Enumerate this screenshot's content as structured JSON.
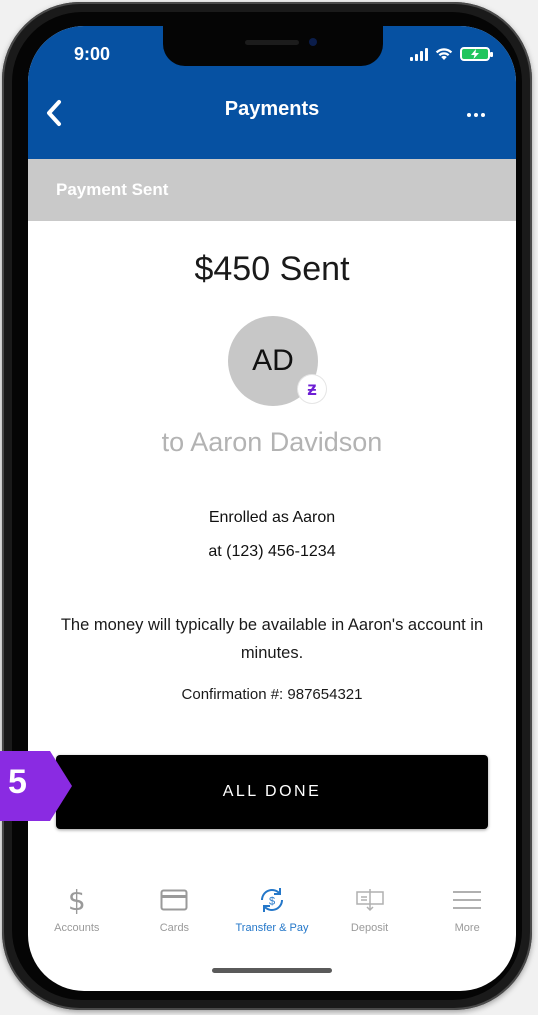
{
  "status_bar": {
    "time": "9:00"
  },
  "header": {
    "title": "Payments"
  },
  "section": {
    "title": "Payment Sent"
  },
  "payment": {
    "amount_text": "$450 Sent",
    "avatar_initials": "AD",
    "recipient_text": "to Aaron Davidson",
    "enrolled_line1": "Enrolled as Aaron",
    "enrolled_line2": "at (123) 456-1234",
    "notice": "The money will typically be available in Aaron's account in minutes.",
    "confirmation": "Confirmation #: 987654321"
  },
  "button": {
    "all_done": "ALL DONE"
  },
  "tabs": [
    {
      "label": "Accounts",
      "icon": "dollar-icon"
    },
    {
      "label": "Cards",
      "icon": "card-icon"
    },
    {
      "label": "Transfer & Pay",
      "icon": "transfer-pay-icon",
      "active": true
    },
    {
      "label": "Deposit",
      "icon": "check-deposit-icon"
    },
    {
      "label": "More",
      "icon": "hamburger-icon"
    }
  ],
  "step_badge": {
    "number": "5"
  },
  "colors": {
    "header_blue": "#0651a2",
    "section_gray": "#c9c9c9",
    "badge_purple": "#8a2be2",
    "zelle_purple": "#6d1ed4",
    "active_tab": "#2477c9"
  }
}
